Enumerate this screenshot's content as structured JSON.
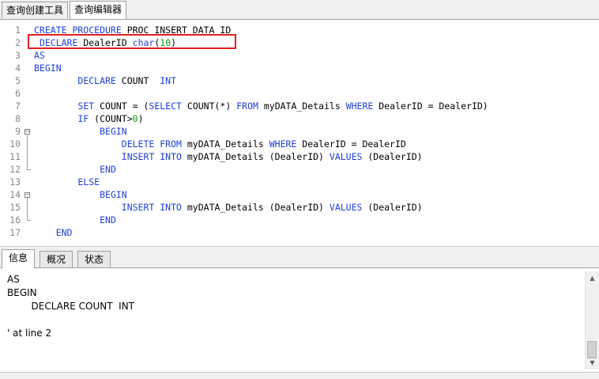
{
  "top_tabs": [
    "查询创建工具",
    "查询编辑器"
  ],
  "editor": {
    "lines": [
      {
        "num": "1",
        "parts": [
          [
            "kw",
            "CREATE PROCEDURE"
          ],
          [
            "t",
            " PROC INSERT DATA_ID"
          ]
        ]
      },
      {
        "num": "2",
        "parts": [
          [
            "t",
            " "
          ],
          [
            "kw",
            "DECLARE"
          ],
          [
            "t",
            " DealerID "
          ],
          [
            "kw",
            "char"
          ],
          [
            "t",
            "("
          ],
          [
            "num",
            "10"
          ],
          [
            "t",
            ")"
          ]
        ]
      },
      {
        "num": "3",
        "parts": [
          [
            "kw",
            "AS"
          ]
        ]
      },
      {
        "num": "4",
        "parts": [
          [
            "kw",
            "BEGIN"
          ]
        ]
      },
      {
        "num": "5",
        "parts": [
          [
            "t",
            "        "
          ],
          [
            "kw",
            "DECLARE"
          ],
          [
            "t",
            " COUNT  "
          ],
          [
            "kw",
            "INT"
          ]
        ]
      },
      {
        "num": "6",
        "parts": []
      },
      {
        "num": "7",
        "parts": [
          [
            "t",
            "        "
          ],
          [
            "kw",
            "SET"
          ],
          [
            "t",
            " COUNT = ("
          ],
          [
            "kw",
            "SELECT"
          ],
          [
            "t",
            " COUNT(*) "
          ],
          [
            "kw",
            "FROM"
          ],
          [
            "t",
            " myDATA_Details "
          ],
          [
            "kw",
            "WHERE"
          ],
          [
            "t",
            " DealerID = DealerID)"
          ]
        ]
      },
      {
        "num": "8",
        "parts": [
          [
            "t",
            "        "
          ],
          [
            "kw",
            "IF"
          ],
          [
            "t",
            " (COUNT>"
          ],
          [
            "num",
            "0"
          ],
          [
            "t",
            ")"
          ]
        ]
      },
      {
        "num": "9",
        "parts": [
          [
            "t",
            "            "
          ],
          [
            "kw",
            "BEGIN"
          ]
        ]
      },
      {
        "num": "10",
        "parts": [
          [
            "t",
            "                "
          ],
          [
            "kw",
            "DELETE FROM"
          ],
          [
            "t",
            " myDATA_Details "
          ],
          [
            "kw",
            "WHERE"
          ],
          [
            "t",
            " DealerID = DealerID"
          ]
        ]
      },
      {
        "num": "11",
        "parts": [
          [
            "t",
            "                "
          ],
          [
            "kw",
            "INSERT INTO"
          ],
          [
            "t",
            " myDATA_Details (DealerID) "
          ],
          [
            "kw",
            "VALUES"
          ],
          [
            "t",
            " (DealerID)"
          ]
        ]
      },
      {
        "num": "12",
        "parts": [
          [
            "t",
            "            "
          ],
          [
            "kw",
            "END"
          ]
        ]
      },
      {
        "num": "13",
        "parts": [
          [
            "t",
            "        "
          ],
          [
            "kw",
            "ELSE"
          ]
        ]
      },
      {
        "num": "14",
        "parts": [
          [
            "t",
            "            "
          ],
          [
            "kw",
            "BEGIN"
          ]
        ]
      },
      {
        "num": "15",
        "parts": [
          [
            "t",
            "                "
          ],
          [
            "kw",
            "INSERT INTO"
          ],
          [
            "t",
            " myDATA_Details (DealerID) "
          ],
          [
            "kw",
            "VALUES"
          ],
          [
            "t",
            " (DealerID)"
          ]
        ]
      },
      {
        "num": "16",
        "parts": [
          [
            "t",
            "            "
          ],
          [
            "kw",
            "END"
          ]
        ]
      },
      {
        "num": "17",
        "parts": [
          [
            "t",
            "    "
          ],
          [
            "kw",
            "END"
          ]
        ]
      }
    ]
  },
  "bottom_tabs": [
    "信息",
    "概况",
    "状态"
  ],
  "message": "AS\nBEGIN\n        DECLARE COUNT  INT\n\n' at line 2",
  "colors": {
    "keyword": "#1f3fd8",
    "number": "#00a000",
    "highlight_border": "#e02020"
  }
}
